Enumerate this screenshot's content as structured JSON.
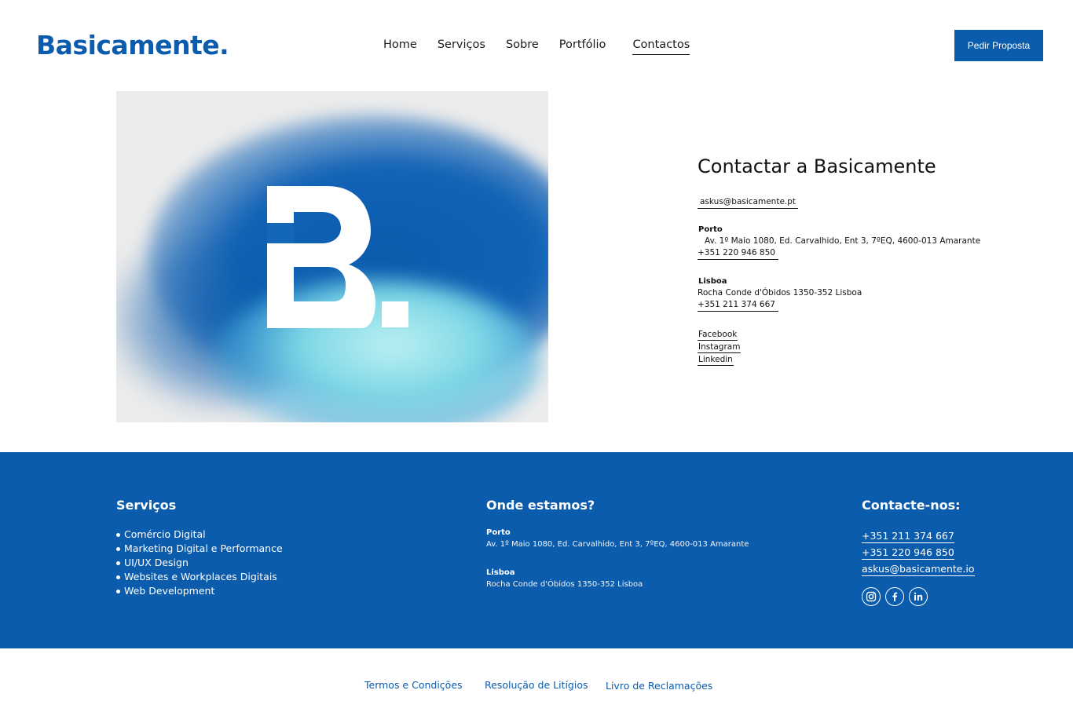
{
  "header": {
    "logo": "Basicamente.",
    "nav": [
      {
        "label": "Home"
      },
      {
        "label": "Serviços"
      },
      {
        "label": "Sobre"
      },
      {
        "label": "Portfólio"
      },
      {
        "label": "Contactos"
      }
    ],
    "cta_label": "Pedir Proposta"
  },
  "contact": {
    "title": "Contactar a Basicamente",
    "email": "askus@basicamente.pt",
    "porto": {
      "city": "Porto",
      "address": "Av. 1º Maio 1080, Ed. Carvalhido, Ent 3, 7ºEQ, 4600-013 Amarante",
      "phone": "+351 220 946 850"
    },
    "lisboa": {
      "city": "Lisboa",
      "address": "Rocha Conde d'Óbidos 1350-352 Lisboa",
      "phone": "+351 211 374 667"
    },
    "social": [
      "Facebook",
      "Instagram",
      "Linkedin"
    ]
  },
  "footer": {
    "services_title": "Serviços",
    "services": [
      "Comércio Digital",
      "Marketing Digital e Performance",
      "UI/UX Design",
      "Websites e Workplaces Digitais",
      "Web Development"
    ],
    "locations_title": "Onde estamos?",
    "porto_city": "Porto",
    "porto_address": "Av. 1º Maio 1080, Ed. Carvalhido, Ent 3, 7ºEQ, 4600-013 Amarante",
    "lisboa_city": "Lisboa",
    "lisboa_address": "Rocha Conde d'Óbidos 1350-352 Lisboa",
    "contact_title": "Contacte-nos:",
    "phone1": "+351 211 374 667",
    "phone2": "+351 220 946 850",
    "email": "askus@basicamente.io",
    "social_icons": [
      "instagram-icon",
      "facebook-icon",
      "linkedin-icon"
    ]
  },
  "legal": {
    "terms": "Termos e Condições",
    "disputes": "Resolução de Litígios",
    "complaints": "Livro de Reclamações"
  },
  "colors": {
    "brand_blue": "#0b5cad",
    "text": "#111111",
    "background": "#ffffff"
  }
}
